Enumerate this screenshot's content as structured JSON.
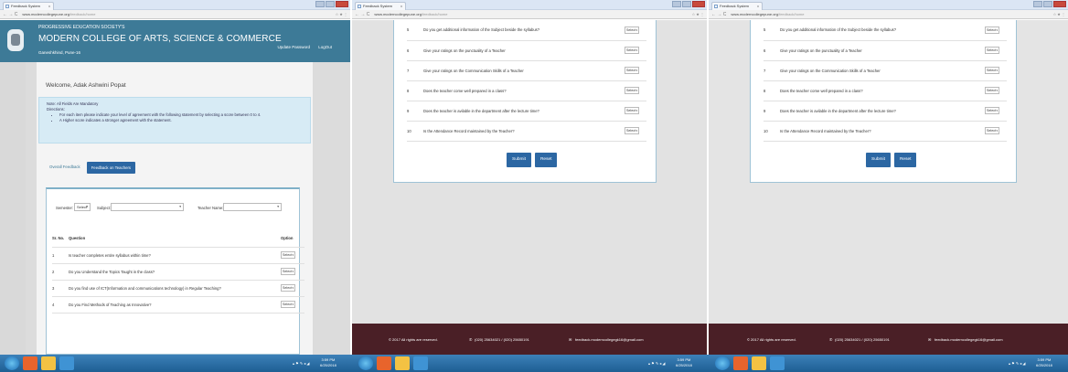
{
  "browser": {
    "tab_label": "Feedback System",
    "tab_close": "x",
    "url_host": "www.moderncollegepune.org",
    "url_path": "/feedback/home",
    "nav_glyphs": "←  →  C",
    "addr_right": "☆ ★ ⋮"
  },
  "header": {
    "society": "PROGRESSIVE EDUCATION SOCIETY'S",
    "college": "MODERN COLLEGE OF ARTS, SCIENCE & COMMERCE",
    "location": "Ganeshkhind, Pune-16",
    "update_password": "Update Password",
    "logout": "LogOut"
  },
  "welcome": "Welcome, Adak Ashwini Popat",
  "notice": {
    "note": "Note: All Fields Are Mandatory",
    "directions": "Directions:",
    "bullets": [
      "For each item please indicate your level of agreement with the following statement by selecting a score between 0 to 4.",
      "A Higher score indicates a stronger agreement with the statement."
    ]
  },
  "tabs": {
    "overall": "Overall Feedback",
    "teachers": "Feedback on Teachers"
  },
  "filters": {
    "semester_label": "Semester:",
    "semester_value": "Select",
    "subject_label": "Subject:",
    "teacher_label": "Teacher Name:"
  },
  "table": {
    "col_no": "Sr. No.",
    "col_question": "Question",
    "col_option": "Option",
    "select_label": "Select",
    "questions_first": [
      {
        "no": "1",
        "q": "Is teacher completes entire syllabus within time?"
      },
      {
        "no": "2",
        "q": "Do you Understand the Topics Taught in the class?"
      },
      {
        "no": "3",
        "q": "Do you find use of ICT(Information and communications technology) in Regular Teaching?"
      },
      {
        "no": "4",
        "q": "Do you Find Methods of Teaching as Innovative?"
      }
    ],
    "questions_last": [
      {
        "no": "5",
        "q": "Do you get additional information of the Subject beside the syllabus?"
      },
      {
        "no": "6",
        "q": "Give your ratings on the punctuality of a Teacher"
      },
      {
        "no": "7",
        "q": "Give your ratings on the Communication Skills of a Teacher"
      },
      {
        "no": "8",
        "q": "Does the teacher come well prepared in a class?"
      },
      {
        "no": "9",
        "q": "Does the teacher is avilable in the department after the lecture time?"
      },
      {
        "no": "10",
        "q": "Is the Attendance Record maintained by the Teacher?"
      }
    ]
  },
  "buttons": {
    "submit": "Submit",
    "reset": "Reset"
  },
  "footer": {
    "copyright": "© 2017 All rights are reserved.",
    "phone": "(020) 25634021 / (020) 25650191",
    "email": "feedback.moderncollegegk16@gmail.com"
  },
  "taskbar": {
    "time": "3:59 PM",
    "date": "6/25/2018",
    "tray": "▴ ⚑ ✎ ◂ ◢"
  },
  "colors": {
    "header": "#3d7a97",
    "primary_button": "#2c67a3",
    "footer": "#4a1f26",
    "notice_bg": "#d7ebf5"
  }
}
